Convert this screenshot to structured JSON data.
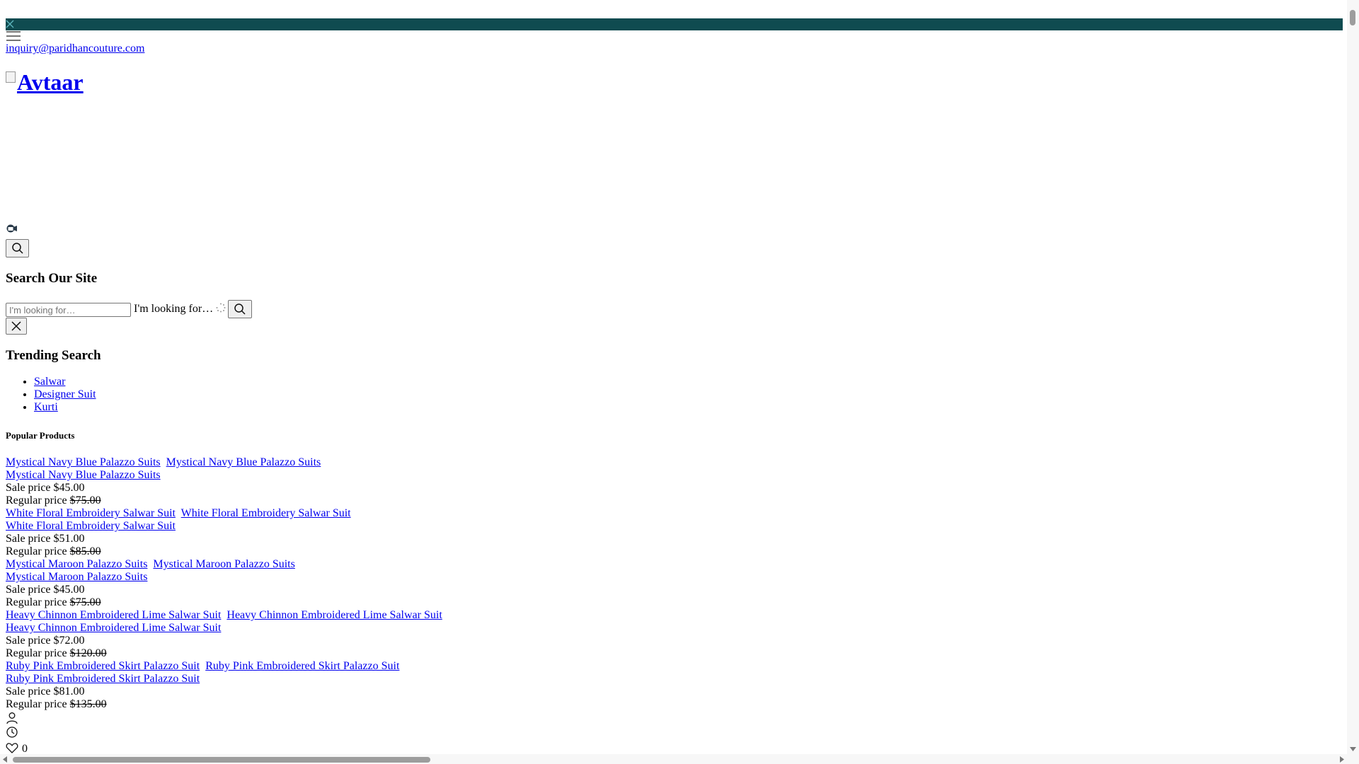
{
  "contact": {
    "email": "inquiry@paridhancouture.com"
  },
  "logo": {
    "alt_text": "Avtaar"
  },
  "search": {
    "title": "Search Our Site",
    "placeholder": "I'm looking for…",
    "label": "I'm looking for…"
  },
  "trending": {
    "title": "Trending Search",
    "items": [
      "Salwar",
      "Designer Suit",
      "Kurti"
    ]
  },
  "popular": {
    "title": "Popular Products",
    "products": [
      {
        "name": "Mystical Navy Blue Palazzo Suits",
        "sale_label": "Sale price",
        "sale_price": "$45.00",
        "regular_label": "Regular price",
        "regular_price": "$75.00"
      },
      {
        "name": "White Floral Embroidery Salwar Suit",
        "sale_label": "Sale price",
        "sale_price": "$51.00",
        "regular_label": "Regular price",
        "regular_price": "$85.00"
      },
      {
        "name": "Mystical Maroon Palazzo Suits",
        "sale_label": "Sale price",
        "sale_price": "$45.00",
        "regular_label": "Regular price",
        "regular_price": "$75.00"
      },
      {
        "name": "Heavy Chinnon Embroidered Lime Salwar Suit",
        "sale_label": "Sale price",
        "sale_price": "$72.00",
        "regular_label": "Regular price",
        "regular_price": "$120.00"
      },
      {
        "name": "Ruby Pink Embroidered Skirt Palazzo Suit",
        "sale_label": "Sale price",
        "sale_price": "$81.00",
        "regular_label": "Regular price",
        "regular_price": "$135.00"
      }
    ]
  },
  "wishlist": {
    "count": "0"
  },
  "colors": {
    "announcement_bar": "#0f4b50",
    "link": "#0000ee"
  },
  "icons": [
    "close-icon",
    "hamburger-menu-icon",
    "video-icon",
    "search-icon",
    "spinner-icon",
    "account-icon",
    "clock-icon",
    "heart-icon"
  ]
}
